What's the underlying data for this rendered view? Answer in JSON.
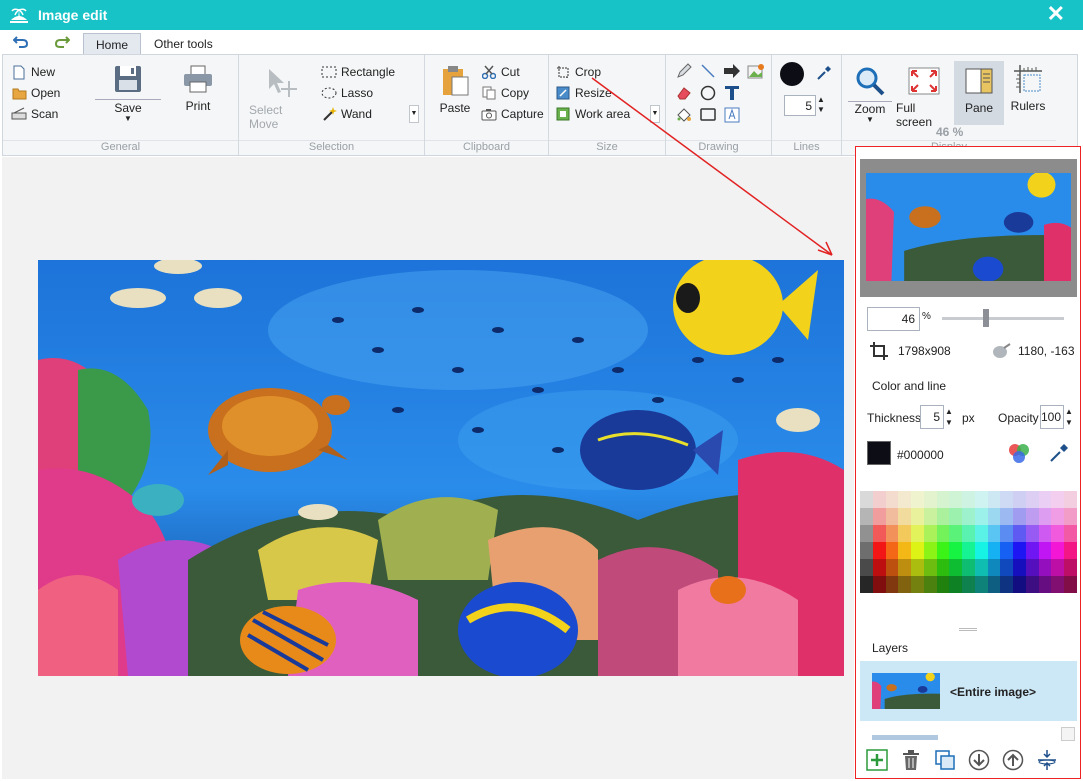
{
  "window": {
    "title": "Image edit",
    "close_label": "✕"
  },
  "tabs": [
    {
      "label": "Home",
      "active": true
    },
    {
      "label": "Other tools",
      "active": false
    }
  ],
  "ribbon": {
    "general": {
      "label": "General",
      "new": "New",
      "open": "Open",
      "scan": "Scan",
      "save": "Save",
      "print": "Print"
    },
    "selection": {
      "label": "Selection",
      "select_move": "Select Move",
      "rectangle": "Rectangle",
      "lasso": "Lasso",
      "wand": "Wand"
    },
    "clipboard": {
      "label": "Clipboard",
      "paste": "Paste",
      "cut": "Cut",
      "copy": "Copy",
      "capture": "Capture"
    },
    "size": {
      "label": "Size",
      "crop": "Crop",
      "resize": "Resize",
      "work_area": "Work area"
    },
    "drawing": {
      "label": "Drawing"
    },
    "lines": {
      "label": "Lines",
      "width_value": "5"
    },
    "display": {
      "label": "Display",
      "zoom": "Zoom",
      "full_screen": "Full screen",
      "pane": "Pane",
      "rulers": "Rulers",
      "zoom_percent": "46 %"
    }
  },
  "panel": {
    "zoom_value": "46",
    "zoom_unit": "%",
    "image_size": "1798x908",
    "cursor_pos": "1180, -163",
    "color_and_line": "Color and line",
    "thickness_label": "Thickness",
    "thickness_value": "5",
    "thickness_unit": "px",
    "opacity_label": "Opacity",
    "opacity_value": "100",
    "color_hex": "#000000",
    "layers_label": "Layers",
    "layer_name": "<Entire image>"
  },
  "colors": {
    "titlebar": "#18c3c8",
    "accent_red": "#e22222",
    "selected_layer": "#cce8f6",
    "pane_active": "#d3dae2"
  }
}
